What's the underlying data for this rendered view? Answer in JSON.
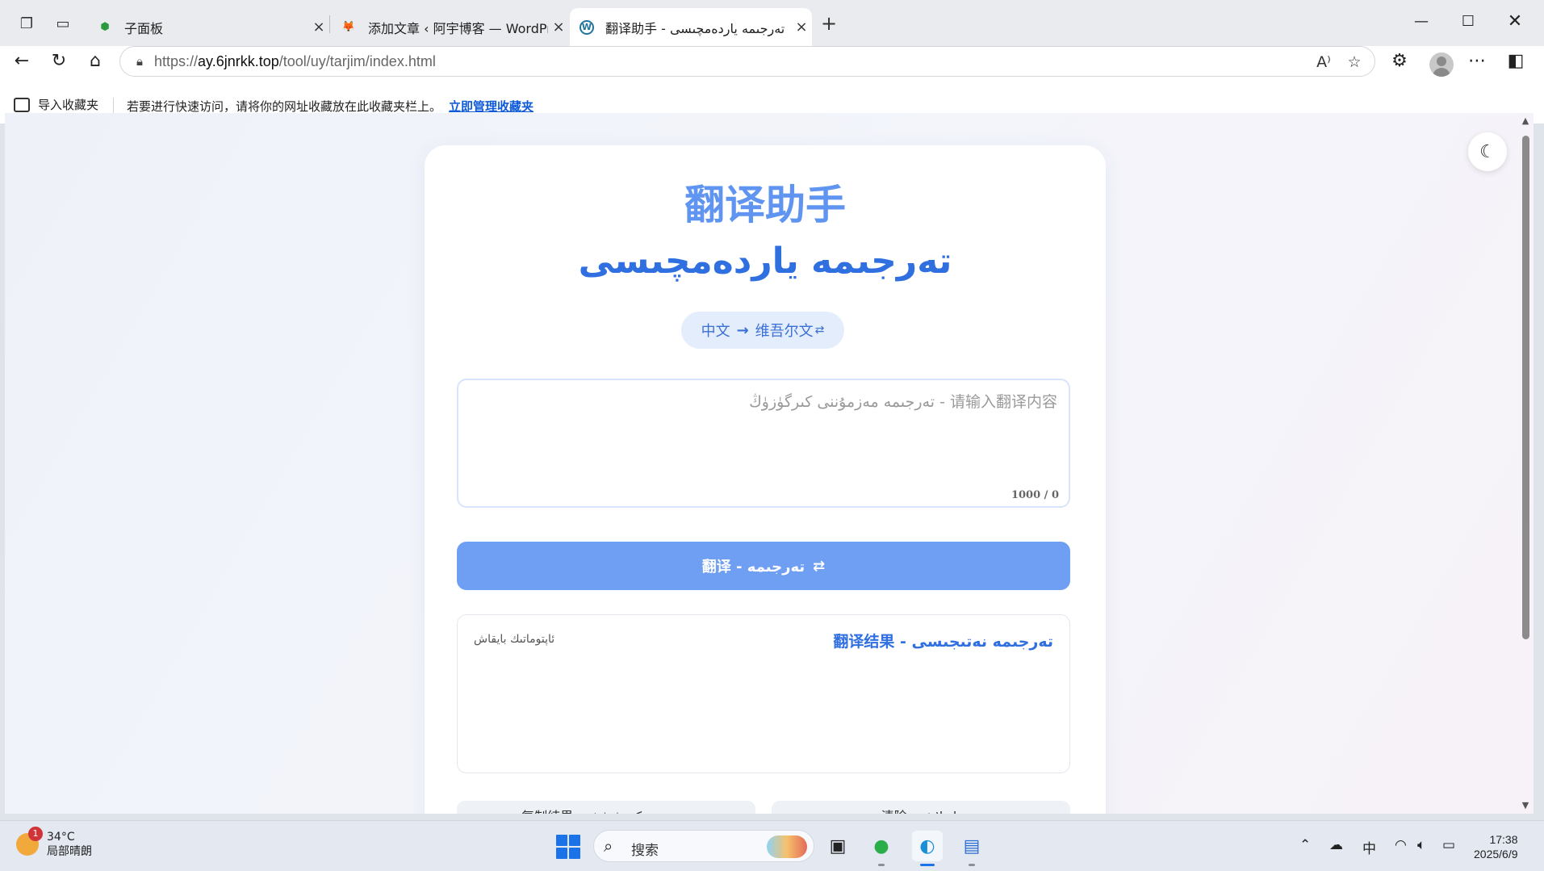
{
  "browser": {
    "tabs": [
      {
        "title": "子面板",
        "favicon": "shield-icon",
        "active": false
      },
      {
        "title": "添加文章 ‹ 阿宇博客 — WordPress",
        "favicon": "fox-icon",
        "active": false
      },
      {
        "title": "翻译助手 - تەرجىمە ياردەمچىسى",
        "favicon": "wordpress-icon",
        "active": true
      }
    ],
    "url_prefix": "https://",
    "url_host": "ay.6jnrkk.top",
    "url_path": "/tool/uy/tarjim/index.html",
    "bookmarks": {
      "import_label": "导入收藏夹",
      "hint": "若要进行快速访问，请将你的网址收藏放在此收藏夹栏上。",
      "manage_link": "立即管理收藏夹"
    }
  },
  "page": {
    "title": "翻译助手",
    "subtitle": "تەرجىمە ياردەمچىسى",
    "lang_pair": {
      "from": "中文",
      "arrow": "→",
      "to": "维吾尔文"
    },
    "input": {
      "placeholder": "请输入翻译内容 - تەرجىمە مەزمۇننى كىرگۈزۈڭ",
      "value": "",
      "counter": "1000 / 0"
    },
    "translate_button": "翻译 - تەرجىمە",
    "result": {
      "title": "翻译结果 - تەرجىمە نەتىجىسى",
      "empty_text": "ئاپتوماتىك بايقاش"
    },
    "actions": [
      {
        "label": "复制结果 - نەتىجىنى كۆچۈرۈش"
      },
      {
        "label": "清除 - تازىلاش"
      }
    ]
  },
  "taskbar": {
    "weather": {
      "temp": "34°C",
      "desc": "局部晴朗",
      "badge": "1"
    },
    "search_label": "搜索",
    "ime": "中",
    "time": "17:38",
    "date": "2025/6/9"
  },
  "colors": {
    "accent": "#5f95f0",
    "subtitle": "#2f6fe0",
    "button": "#6f9ff3",
    "pill_bg": "#e4edfc"
  }
}
